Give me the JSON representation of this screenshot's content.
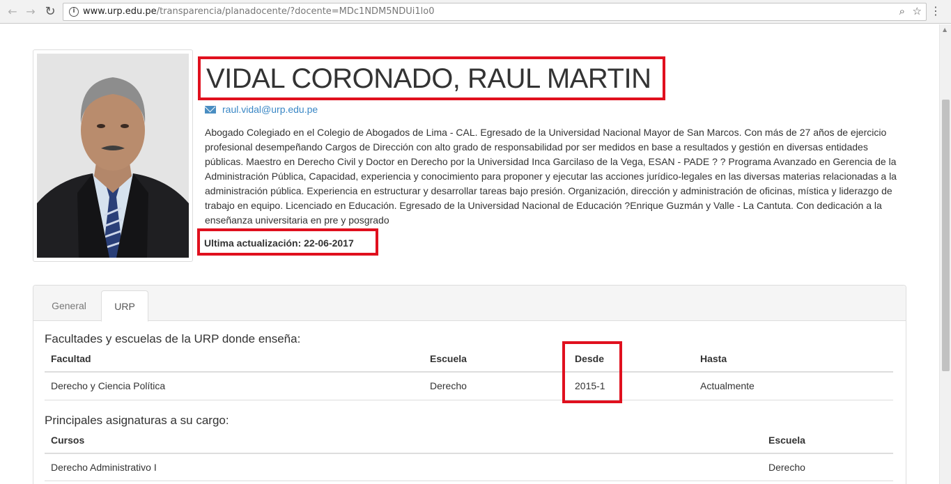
{
  "browser": {
    "url_host": "www.urp.edu.pe",
    "url_path": "/transparencia/planadocente/?docente=MDc1NDM5NDUi1lo0",
    "icons": [
      "back-arrow-icon",
      "forward-arrow-icon",
      "reload-icon",
      "info-icon",
      "zoom-icon",
      "star-icon",
      "menu-icon"
    ]
  },
  "profile": {
    "name": "VIDAL CORONADO, RAUL MARTIN",
    "email": "raul.vidal@urp.edu.pe",
    "bio": "Abogado Colegiado en el Colegio de Abogados de Lima - CAL. Egresado de la Universidad Nacional Mayor de San Marcos. Con más de 27 años de ejercicio profesional desempeñando Cargos de Dirección con alto grado de responsabilidad por ser medidos en base a resultados y gestión en diversas entidades públicas. Maestro en Derecho Civil y Doctor en Derecho por la Universidad Inca Garcilaso de la Vega, ESAN - PADE ? ? Programa Avanzado en Gerencia de la Administración Pública, Capacidad, experiencia y conocimiento para proponer y ejecutar las acciones jurídico-legales en las diversas materias relacionadas a la administración pública. Experiencia en estructurar y desarrollar tareas bajo presión. Organización, dirección y administración de oficinas, mística y liderazgo de trabajo en equipo. Licenciado en Educación. Egresado de la Universidad Nacional de Educación ?Enrique Guzmán y Valle - La Cantuta. Con dedicación a la enseñanza universitaria en pre y posgrado",
    "last_update": "Ultima actualización: 22-06-2017"
  },
  "tabs": [
    {
      "label": "General",
      "active": false
    },
    {
      "label": "URP",
      "active": true
    }
  ],
  "faculties": {
    "title": "Facultades y escuelas de la URP donde enseña:",
    "headers": [
      "Facultad",
      "Escuela",
      "Desde",
      "Hasta"
    ],
    "rows": [
      [
        "Derecho y Ciencia Política",
        "Derecho",
        "2015-1",
        "Actualmente"
      ]
    ]
  },
  "courses": {
    "title": "Principales asignaturas a su cargo:",
    "headers": [
      "Cursos",
      "Escuela"
    ],
    "rows": [
      [
        "Derecho Administrativo I",
        "Derecho"
      ]
    ]
  },
  "colors": {
    "highlight": "#e0101e",
    "link": "#3a87c5",
    "text": "#333333"
  }
}
